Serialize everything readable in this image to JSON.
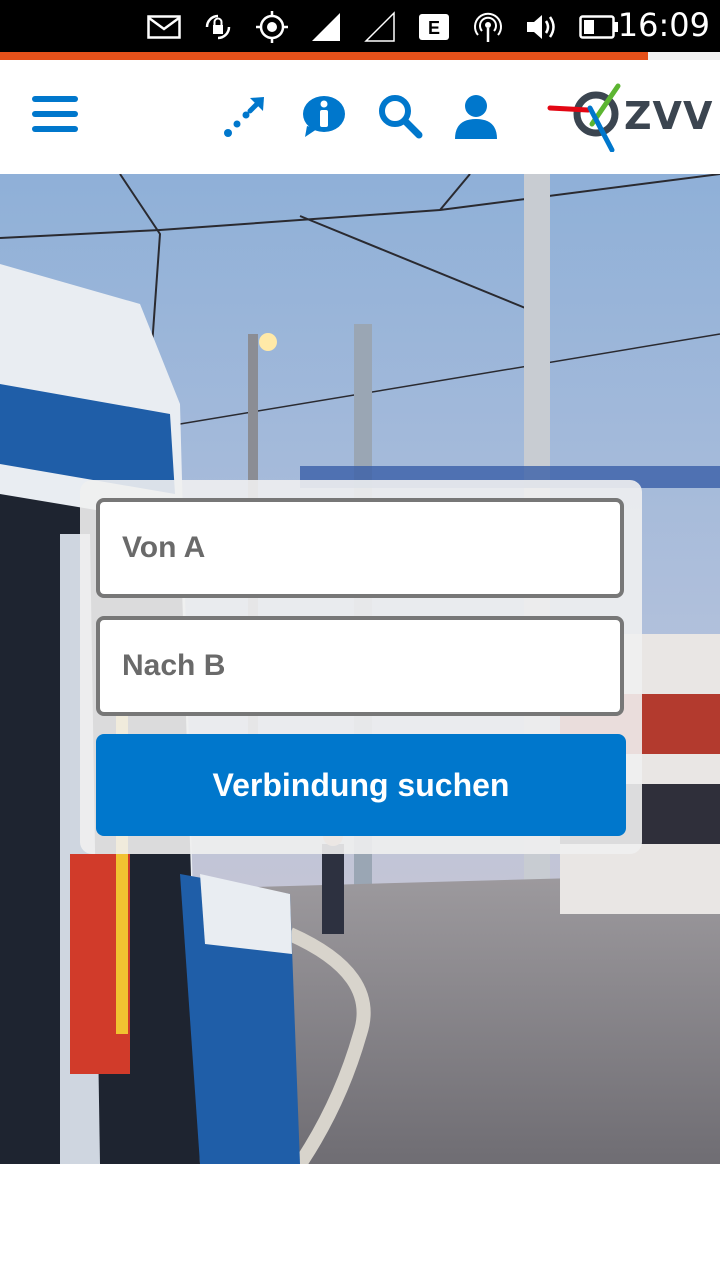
{
  "status_bar": {
    "time": "16:09",
    "network_badge": "E",
    "icons": [
      "mail-icon",
      "rotation-lock-icon",
      "gps-icon",
      "signal-full-icon",
      "signal-empty-icon",
      "network-type-icon",
      "hotspot-icon",
      "volume-icon",
      "battery-icon"
    ]
  },
  "page_load_progress": 0.9,
  "nav": {
    "menu_icon": "hamburger-menu-icon",
    "connection_icon": "connection-arrow-icon",
    "info_icon": "info-icon",
    "search_icon": "search-icon",
    "user_icon": "user-icon"
  },
  "logo": {
    "text": "ZVV"
  },
  "search_form": {
    "from_placeholder": "Von A",
    "to_placeholder": "Nach B",
    "submit_label": "Verbindung suchen"
  },
  "colors": {
    "brand_blue": "#0077cc",
    "progress_orange": "#e5511a",
    "logo_red": "#e30613",
    "logo_green": "#5cb531"
  }
}
